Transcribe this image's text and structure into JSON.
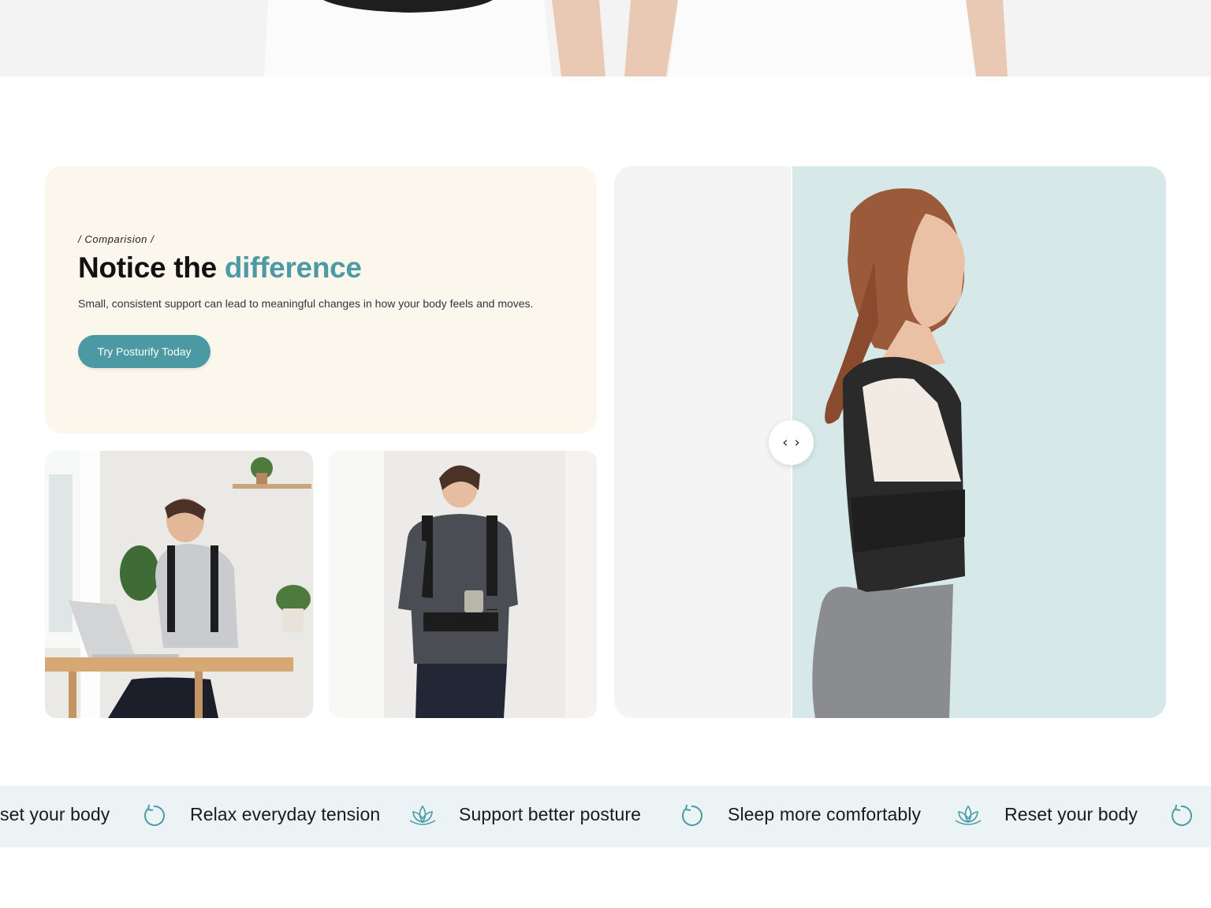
{
  "comparison": {
    "eyebrow": "/ Comparision /",
    "headline_main": "Notice the ",
    "headline_accent": "difference",
    "subcopy": "Small, consistent support can lead to meaningful changes in how your body feels and moves.",
    "cta_label": "Try Posturify Today"
  },
  "slider": {
    "prev_icon": "chevron-left-icon",
    "next_icon": "chevron-right-icon",
    "prev_glyph": "‹",
    "next_glyph": "›"
  },
  "marquee": {
    "items": [
      {
        "text": "set your body",
        "icon": "refresh-icon"
      },
      {
        "text": "Relax everyday tension",
        "icon": "lotus-icon"
      },
      {
        "text": "Support better posture",
        "icon": "refresh-icon"
      },
      {
        "text": "Sleep more comfortably",
        "icon": "lotus-icon"
      },
      {
        "text": "Reset your body",
        "icon": "refresh-icon"
      }
    ]
  },
  "colors": {
    "accent": "#4b9aa6",
    "card_bg": "#fcf7ec",
    "marquee_bg": "#ecf3f5",
    "slider_after_bg": "#d6e8e8"
  }
}
